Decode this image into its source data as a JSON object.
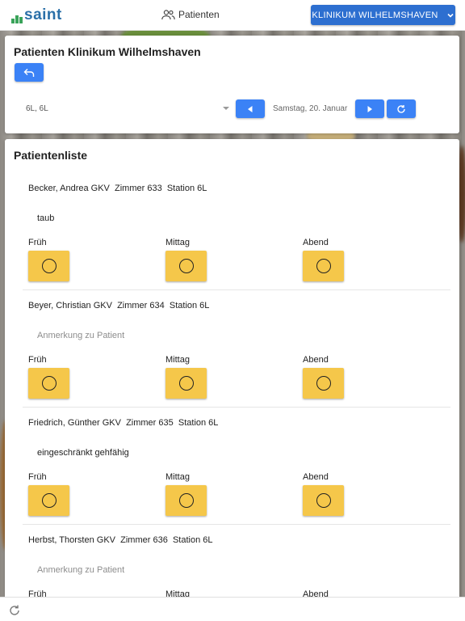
{
  "brand": {
    "name": "saint",
    "logo_color": "#2a6fa8",
    "mark_color": "#3aa35a"
  },
  "nav": {
    "patients_label": "Patienten",
    "patients_icon": "users-icon"
  },
  "clinic_button": {
    "label": "KLINIKUM WILHELMSHAVEN",
    "icon": "chevron-down-icon",
    "color": "#2d6fd0"
  },
  "header_card": {
    "title": "Patienten Klinikum Wilhelmshaven",
    "back_icon": "undo-arrow-icon",
    "station_select": {
      "value": "6L, 6L"
    },
    "date": "Samstag, 20. Januar",
    "prev_icon": "triangle-left-icon",
    "next_icon": "triangle-right-icon",
    "refresh_icon": "refresh-icon",
    "accent": "#3b82f6"
  },
  "patient_list": {
    "title": "Patientenliste",
    "meal_labels": {
      "breakfast": "Früh",
      "lunch": "Mittag",
      "dinner": "Abend"
    },
    "meal_button_color": "#f5c74a",
    "note_placeholder": "Anmerkung zu Patient",
    "patients": [
      {
        "name": "Becker, Andrea GKV",
        "room": "Zimmer 633",
        "station": "Station 6L",
        "note": "taub"
      },
      {
        "name": "Beyer, Christian GKV",
        "room": "Zimmer 634",
        "station": "Station 6L",
        "note": ""
      },
      {
        "name": "Friedrich, Günther GKV",
        "room": "Zimmer 635",
        "station": "Station 6L",
        "note": "eingeschränkt gehfähig"
      },
      {
        "name": "Herbst, Thorsten GKV",
        "room": "Zimmer 636",
        "station": "Station 6L",
        "note": ""
      }
    ]
  },
  "bottom_bar": {
    "reload_icon": "reload-icon"
  }
}
